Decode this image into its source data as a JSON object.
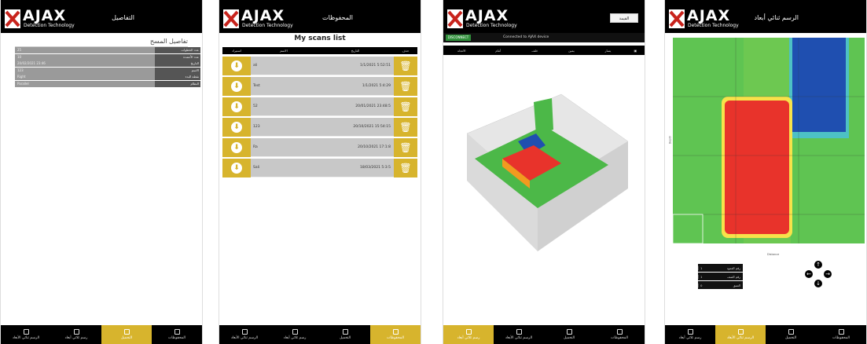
{
  "brand": {
    "logo_text": "AJAX",
    "logo_sub": "Detection Technology"
  },
  "screen1": {
    "title": "التفاصيل",
    "section_title": "تفاصيل المسح",
    "rows": [
      {
        "key": "عدد الخطوات",
        "value": "25"
      },
      {
        "key": "عدد الأعمدة",
        "value": "10"
      },
      {
        "key": "التاريخ",
        "value": "20/02/2021 23:46"
      },
      {
        "key": "الاسم",
        "value": "123"
      },
      {
        "key": "نقطة البدء",
        "value": "Right"
      },
      {
        "key": "النظام",
        "value": "Parallel"
      }
    ],
    "nav": [
      {
        "label": "الرسم ثنائي الأبعاد",
        "icon": "grid-icon"
      },
      {
        "label": "رسم ثلاثي أبعاد",
        "icon": "grid-icon"
      },
      {
        "label": "التحميل",
        "icon": "folder-icon"
      },
      {
        "label": "المحفوظات",
        "icon": "list-icon"
      }
    ],
    "active_nav": 2
  },
  "screen2": {
    "title": "المحفوظات",
    "list_title": "My scans list",
    "headers": {
      "load": "استيراد",
      "name": "الاسم",
      "date": "التاريخ",
      "delete": "حذف"
    },
    "rows": [
      {
        "name": "ali",
        "date": "1/1/2021 5:52:51"
      },
      {
        "name": "Test",
        "date": "1/1/2021 5:4:29"
      },
      {
        "name": "52",
        "date": "20/01/2021 23:48:5"
      },
      {
        "name": "123",
        "date": "20/10/2021 15:54:15"
      },
      {
        "name": "Ra",
        "date": "20/10/2021 17:1:8"
      },
      {
        "name": "Sali",
        "date": "18/03/2021 5:3:5"
      }
    ],
    "nav": [
      {
        "label": "الرسم ثنائي الأبعاد",
        "icon": "grid-icon"
      },
      {
        "label": "رسم ثلاثي أبعاد",
        "icon": "grid-icon"
      },
      {
        "label": "التحميل",
        "icon": "folder-icon"
      },
      {
        "label": "المحفوظات",
        "icon": "list-icon"
      }
    ],
    "active_nav": 3
  },
  "screen3": {
    "button": "القيمة",
    "disconnect": "DISCONNECT",
    "connection": "Connected to AJAX device",
    "tools": [
      "الاتجاه",
      "أمام",
      "خلف",
      "يمين",
      "يسار"
    ],
    "nav": [
      {
        "label": "رسم ثلاثي أبعاد",
        "icon": "grid-icon"
      },
      {
        "label": "الرسم ثنائي الأبعاد",
        "icon": "grid-icon"
      },
      {
        "label": "التحميل",
        "icon": "folder-icon"
      },
      {
        "label": "المحفوظات",
        "icon": "list-icon"
      }
    ],
    "active_nav": 0,
    "colors": {
      "green": "#4cb848",
      "red": "#e8332b",
      "blue": "#1f4fb0"
    }
  },
  "screen4": {
    "title": "الرسم ثنائي أبعاد",
    "x_label": "Distance",
    "y_label": "Depth",
    "info": [
      {
        "label": "رقم العمود",
        "value": "1"
      },
      {
        "label": "رقم الصف",
        "value": "1"
      },
      {
        "label": "العمق",
        "value": "0"
      }
    ],
    "nav": [
      {
        "label": "رسم ثلاثي أبعاد",
        "icon": "grid-icon"
      },
      {
        "label": "الرسم ثنائي الأبعاد",
        "icon": "grid-icon"
      },
      {
        "label": "التحميل",
        "icon": "folder-icon"
      },
      {
        "label": "المحفوظات",
        "icon": "list-icon"
      }
    ],
    "active_nav": 1
  },
  "accent": "#d7b42d"
}
